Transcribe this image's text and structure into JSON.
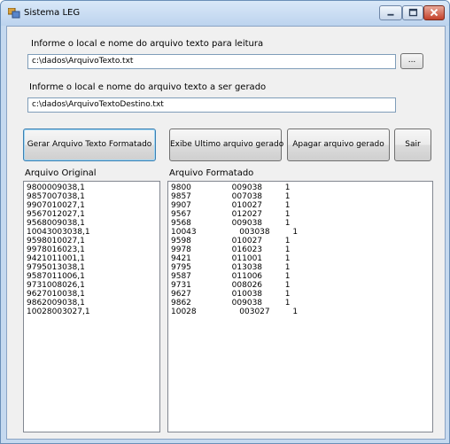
{
  "window": {
    "title": "Sistema LEG",
    "controls": {
      "minimize_icon": "minimize-icon",
      "maximize_icon": "maximize-icon",
      "close_icon": "close-icon"
    },
    "colors": {
      "frame": "#c5d9ef",
      "client": "#f0f0f0",
      "close": "#c4402a"
    }
  },
  "input_section": {
    "label": "Informe o local e nome do arquivo texto para leitura",
    "value": "c:\\dados\\ArquivoTexto.txt",
    "browse_label": "..."
  },
  "output_section": {
    "label": "Informe o local e nome do arquivo  texto a ser gerado",
    "value": "c:\\dados\\ArquivoTextoDestino.txt"
  },
  "buttons": {
    "generate": "Gerar Arquivo Texto Formatado",
    "show_last": "Exibe Ultimo arquivo gerado",
    "delete": "Apagar arquivo gerado",
    "exit": "Sair"
  },
  "original": {
    "label": "Arquivo Original",
    "lines": [
      "9800009038,1",
      "9857007038,1",
      "9907010027,1",
      "9567012027,1",
      "9568009038,1",
      "10043003038,1",
      "9598010027,1",
      "9978016023,1",
      "9421011001,1",
      "9795013038,1",
      "9587011006,1",
      "9731008026,1",
      "9627010038,1",
      "9862009038,1",
      "10028003027,1"
    ]
  },
  "formatted": {
    "label": "Arquivo Formatado",
    "lines": [
      "9800                009038         1",
      "9857                007038         1",
      "9907                010027         1",
      "9567                012027         1",
      "9568                009038         1",
      "10043                 003038         1",
      "9598                010027         1",
      "9978                016023         1",
      "9421                011001         1",
      "9795                013038         1",
      "9587                011006         1",
      "9731                008026         1",
      "9627                010038         1",
      "9862                009038         1",
      "10028                 003027         1"
    ]
  }
}
